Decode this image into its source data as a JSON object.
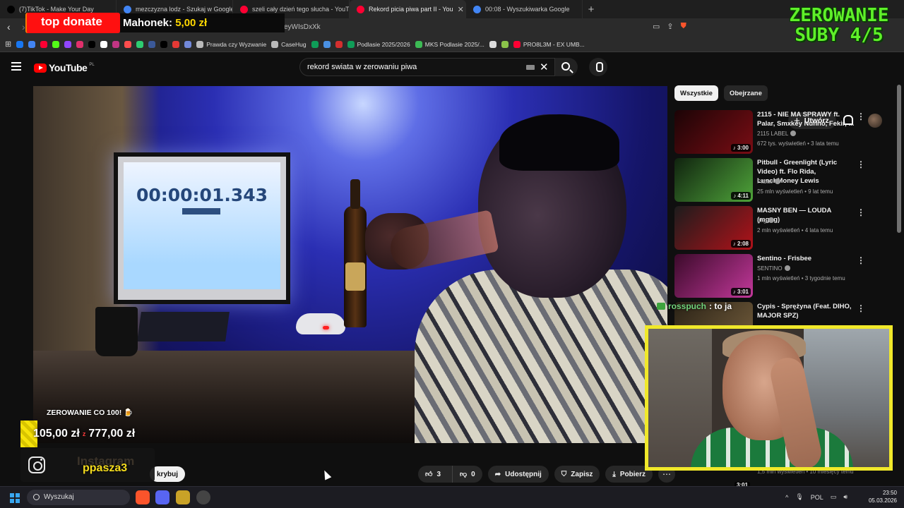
{
  "browser": {
    "tabs": [
      {
        "label": "(7)TikTok - Make Your Day",
        "color": "#000000",
        "active": false,
        "icon": "tiktok-icon"
      },
      {
        "label": "mezczyzna lodz - Szukaj w Google",
        "color": "#4285f4",
        "active": false,
        "icon": "google-icon"
      },
      {
        "label": "szeli cały dzień tego słucha - YouTube",
        "color": "#ff0033",
        "active": false,
        "icon": "youtube-icon"
      },
      {
        "label": "Rekord picia piwa part II - You",
        "color": "#ff0033",
        "active": true,
        "icon": "youtube-icon"
      },
      {
        "label": "00:08 - Wyszukiwarka Google",
        "color": "#4285f4",
        "active": false,
        "icon": "google-icon"
      }
    ],
    "new_tab": "+",
    "url_fragment": "eyWIsDxXk",
    "bookmarks": [
      {
        "label": "",
        "color": "#1877f2"
      },
      {
        "label": "",
        "color": "#4285f4"
      },
      {
        "label": "",
        "color": "#ff0033"
      },
      {
        "label": "",
        "color": "#53fc18"
      },
      {
        "label": "",
        "color": "#9146ff"
      },
      {
        "label": "",
        "color": "#e1306c"
      },
      {
        "label": "",
        "color": "#000000"
      },
      {
        "label": "",
        "color": "#ffffff"
      },
      {
        "label": "",
        "color": "#c13584"
      },
      {
        "label": "",
        "color": "#ff4d4d"
      },
      {
        "label": "",
        "color": "#2ecc71"
      },
      {
        "label": "",
        "color": "#3b5998"
      },
      {
        "label": "",
        "color": "#000000"
      },
      {
        "label": "",
        "color": "#e53935"
      },
      {
        "label": "",
        "color": "#7289da"
      },
      {
        "label": "Prawda czy Wyzwanie",
        "color": "#bbbbbb"
      },
      {
        "label": "CaseHug",
        "color": "#bbbbbb"
      },
      {
        "label": "",
        "color": "#0f9d58"
      },
      {
        "label": "",
        "color": "#4a90e2"
      },
      {
        "label": "",
        "color": "#d32f2f"
      },
      {
        "label": "Podlasie 2025/2026",
        "color": "#0f9d58"
      },
      {
        "label": "MKS Podlasie 2025/...",
        "color": "#3cba54"
      },
      {
        "label": "",
        "color": "#dddddd"
      },
      {
        "label": "",
        "color": "#8bc34a"
      },
      {
        "label": "PRO8L3M - EX UMB...",
        "color": "#ff0033"
      }
    ]
  },
  "youtube": {
    "logo": "YouTube",
    "logo_region": "PL",
    "search_query": "rekord swiata w zerowaniu piwa",
    "create_label": "Utwórz",
    "player": {
      "timer": "00:00:01.343",
      "caption": "ZEROWANIE CO 100! 🍺",
      "goal_current": "105,00 zł",
      "goal_sep": "z",
      "goal_total": "777,00 zł"
    },
    "show_more": "krybuj",
    "actions": {
      "likes": "3",
      "dislikes": "0",
      "share": "Udostępnij",
      "save": "Zapisz",
      "download": "Pobierz",
      "more": "⋯"
    },
    "chips": [
      {
        "label": "Wszystkie",
        "active": true
      },
      {
        "label": "Obejrzane",
        "active": false
      }
    ],
    "recommendations": [
      {
        "title": "2115 - NIE MA SPRAWY ft. Palar, Smxkey Nunno, Fekir, ...",
        "channel": "2115 LABEL",
        "meta": "672 tys. wyświetleń • 3 lata temu",
        "duration": "♪ 3:00",
        "thumb_colors": [
          "#1b0406",
          "#7a0d14"
        ]
      },
      {
        "title": "Pitbull - Greenlight (Lyric Video) ft. Flo Rida, LunchMoney Lewis",
        "channel": "Pitbull",
        "meta": "25 mln wyświetleń • 9 lat temu",
        "duration": "♪ 4:11",
        "thumb_colors": [
          "#10230f",
          "#4fa43a"
        ]
      },
      {
        "title": "MASNY BEN — LOUDA (mgng)",
        "channel": "gng",
        "meta": "2 mln wyświetleń • 4 lata temu",
        "duration": "♪ 2:08",
        "thumb_colors": [
          "#1c1c1c",
          "#b1121a"
        ]
      },
      {
        "title": "Sentino - Frisbee",
        "channel": "SENTINO",
        "meta": "1 mln wyświetleń • 3 tygodnie temu",
        "duration": "♪ 3:01",
        "thumb_colors": [
          "#3b0a2a",
          "#c2389a"
        ]
      },
      {
        "title": "Cypis - Sprężyna (Feat. DIHO, MAJOR SPZ)",
        "channel": "",
        "meta": "",
        "duration": "",
        "thumb_colors": [
          "#2a2216",
          "#735d3c"
        ]
      }
    ],
    "hidden_reco_meta": "1,5 mln wyświetleń • 10 miesięcy temu",
    "hidden_reco_duration": "3:01"
  },
  "stream_overlay": {
    "top_donate_label": "top donate",
    "top_donor": "Mahonek:",
    "top_donor_amount": "5,00 zł",
    "goal_banner_line1": "ZEROWANIE",
    "goal_banner_line2": "SUBY 4/5",
    "chat_user": "rosspuch",
    "chat_message": ": to ja",
    "instagram_label": "Instagram",
    "instagram_user": "ppasza3"
  },
  "taskbar": {
    "search_placeholder": "Wyszukaj",
    "language": "POL",
    "time": "23:50",
    "date": "05.03.2026",
    "chevron": "^"
  }
}
